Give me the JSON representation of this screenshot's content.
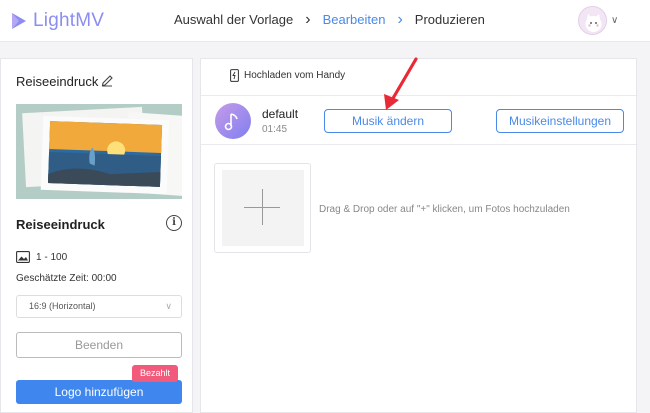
{
  "app": {
    "brand": "LightMV",
    "brand_color": "#8b8ef0",
    "accent": "#4a89e8"
  },
  "steps": [
    {
      "label": "Auswahl der Vorlage",
      "state": "done"
    },
    {
      "label": "Bearbeiten",
      "state": "active"
    },
    {
      "label": "Produzieren",
      "state": "upcoming"
    }
  ],
  "sidebar": {
    "title": "Reiseeindruck",
    "template_name": "Reiseeindruck",
    "photo_range": "1 - 100",
    "estimated_time": "Geschätzte Zeit: 00:00",
    "aspect_select": "16:9 (Horizontal)",
    "end_button": "Beenden",
    "logo_button": "Logo hinzufügen",
    "paid_badge": "Bezahlt",
    "paid_color": "#f25a7c"
  },
  "main": {
    "upload_phone": "Hochladen vom Handy",
    "music": {
      "track_name": "default",
      "duration": "01:45",
      "change_button": "Musik ändern",
      "settings_button": "Musikeinstellungen"
    },
    "drop_hint": "Drag & Drop oder auf \"+\" klicken, um Fotos hochzuladen"
  },
  "icons": [
    "lightmv-logo-icon",
    "edit-icon",
    "info-icon",
    "image-icon",
    "phone-icon",
    "music-note-icon",
    "plus-icon",
    "chevron-down-icon",
    "avatar-icon"
  ]
}
